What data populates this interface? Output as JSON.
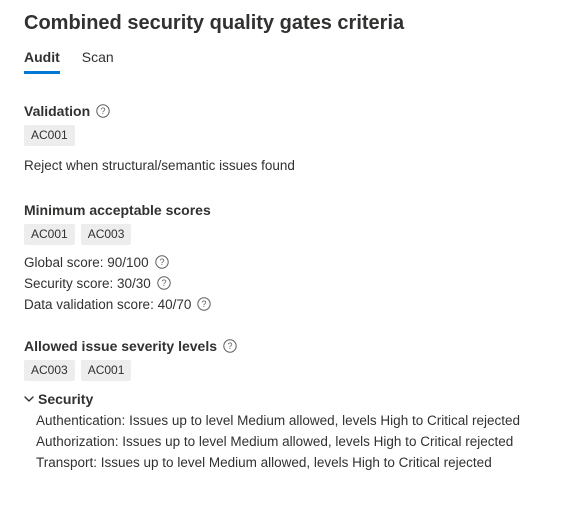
{
  "title": "Combined security quality gates criteria",
  "tabs": {
    "audit": "Audit",
    "scan": "Scan"
  },
  "sections": {
    "validation": {
      "title": "Validation",
      "chips": [
        "AC001"
      ],
      "text": "Reject when structural/semantic issues found"
    },
    "scores": {
      "title": "Minimum acceptable scores",
      "chips": [
        "AC001",
        "AC003"
      ],
      "rows": [
        "Global score: 90/100",
        "Security score: 30/30",
        "Data validation score: 40/70"
      ]
    },
    "severity": {
      "title": "Allowed issue severity levels",
      "chips": [
        "AC003",
        "AC001"
      ],
      "group": "Security",
      "rows": [
        "Authentication: Issues up to level Medium allowed, levels High to Critical rejected",
        "Authorization: Issues up to level Medium allowed, levels High to Critical rejected",
        "Transport: Issues up to level Medium allowed, levels High to Critical rejected"
      ]
    }
  }
}
